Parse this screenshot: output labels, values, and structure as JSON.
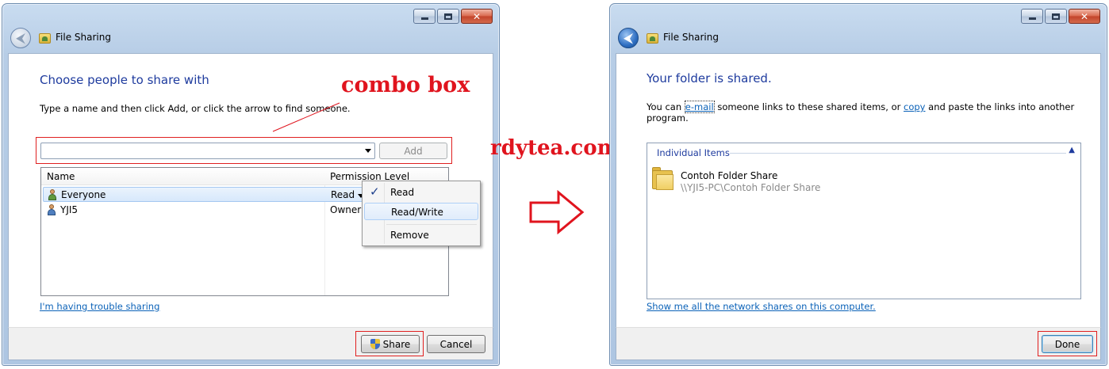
{
  "left_window": {
    "title": "File Sharing",
    "heading": "Choose people to share with",
    "instruction": "Type a name and then click Add, or click the arrow to find someone.",
    "combo_value": "",
    "add_label": "Add",
    "columns": {
      "name": "Name",
      "permission": "Permission Level"
    },
    "rows": [
      {
        "name": "Everyone",
        "permission": "Read",
        "icon": "group-icon"
      },
      {
        "name": "YJI5",
        "permission": "Owner",
        "icon": "user-icon"
      }
    ],
    "menu": {
      "items": [
        "Read",
        "Read/Write",
        "Remove"
      ],
      "checked": "Read"
    },
    "trouble_link": "I'm having trouble sharing",
    "share_label": "Share",
    "cancel_label": "Cancel"
  },
  "right_window": {
    "title": "File Sharing",
    "heading": "Your folder is shared.",
    "msg_prefix": "You can",
    "email_link": "e-mail",
    "msg_middle": "someone links to these shared items, or",
    "copy_link": "copy",
    "msg_suffix": "and paste the links into another program.",
    "group_title": "Individual Items",
    "item_name": "Contoh Folder Share",
    "item_path": "\\\\YJI5-PC\\Contoh Folder Share",
    "network_link": "Show me all the network shares on this computer.",
    "done_label": "Done"
  },
  "annotations": {
    "combo_label": "combo box",
    "watermark": "rdytea.com"
  },
  "colors": {
    "accent_heading": "#1e3b9e",
    "link": "#0b62b8",
    "annotation": "#e0141e"
  }
}
